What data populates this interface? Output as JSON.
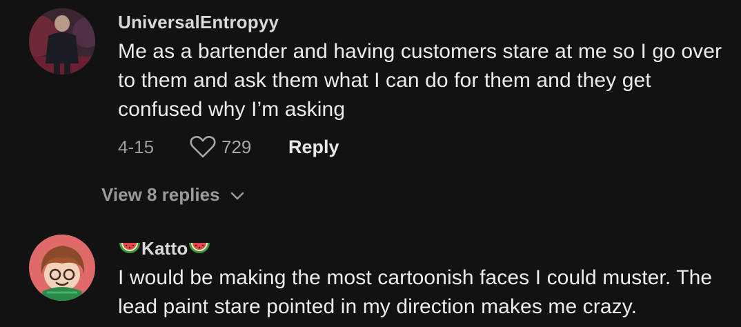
{
  "comments": [
    {
      "username": "UniversalEntropyy",
      "text": "Me as a bartender and having customers stare at me so I go over to them and ask them what I can do for them and they get confused why I’m asking",
      "date": "4-15",
      "likes": "729",
      "reply_label": "Reply",
      "view_replies": "View 8 replies"
    },
    {
      "username": "Katto",
      "username_decoration": "watermelon-icon",
      "text": "I would be making the most cartoonish faces I could muster. The lead paint stare pointed in my direction makes me crazy."
    }
  ],
  "icons": {
    "like": "heart-outline-icon",
    "expand": "chevron-down-icon"
  },
  "colors": {
    "background": "#121212",
    "username": "#d9d9d9",
    "text": "#ececec",
    "muted": "#9a9a9a",
    "avatar2_bg": "#e06a6a"
  }
}
